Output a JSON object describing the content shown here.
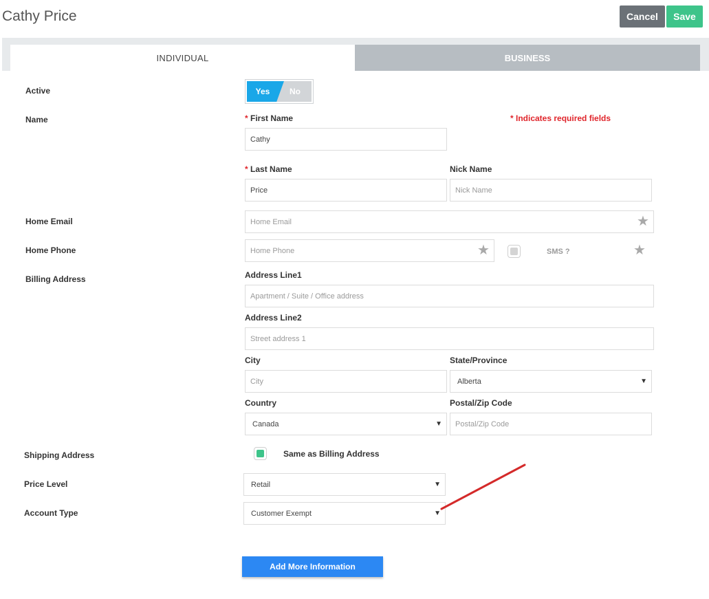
{
  "header": {
    "title": "Cathy Price",
    "cancel_label": "Cancel",
    "save_label": "Save"
  },
  "tabs": [
    {
      "label": "INDIVIDUAL",
      "active": true
    },
    {
      "label": "BUSINESS",
      "active": false
    }
  ],
  "required_note": "* Indicates required fields",
  "active": {
    "label": "Active",
    "yes_label": "Yes",
    "no_label": "No",
    "value": "Yes"
  },
  "name": {
    "label": "Name",
    "first_name_label": "First Name",
    "first_name_value": "Cathy",
    "last_name_label": "Last Name",
    "last_name_value": "Price",
    "nick_name_label": "Nick Name",
    "nick_name_placeholder": "Nick Name"
  },
  "home_email": {
    "label": "Home Email",
    "placeholder": "Home Email"
  },
  "home_phone": {
    "label": "Home Phone",
    "placeholder": "Home Phone",
    "sms_label": "SMS ?"
  },
  "billing_address": {
    "label": "Billing Address",
    "line1_label": "Address Line1",
    "line1_placeholder": "Apartment / Suite / Office address",
    "line2_label": "Address Line2",
    "line2_placeholder": "Street address 1",
    "city_label": "City",
    "city_placeholder": "City",
    "state_label": "State/Province",
    "state_value": "Alberta",
    "country_label": "Country",
    "country_value": "Canada",
    "postal_label": "Postal/Zip Code",
    "postal_placeholder": "Postal/Zip Code"
  },
  "shipping_address": {
    "label": "Shipping Address",
    "same_as_billing_label": "Same as Billing Address",
    "same_as_billing_checked": true
  },
  "price_level": {
    "label": "Price Level",
    "value": "Retail"
  },
  "account_type": {
    "label": "Account Type",
    "value": "Customer Exempt"
  },
  "add_more_label": "Add More Information",
  "colors": {
    "save": "#3ec48a",
    "cancel": "#6b7177",
    "toggle_yes": "#1aa7e8",
    "required": "#e0252b",
    "primary": "#2c88f3",
    "annotation_arrow": "#d42a2a"
  }
}
